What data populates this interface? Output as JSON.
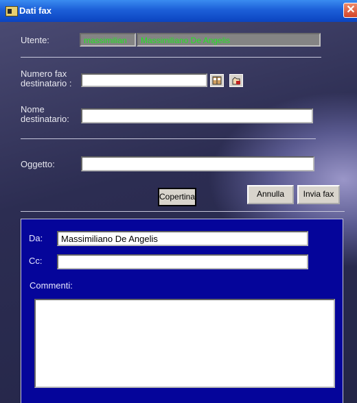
{
  "window": {
    "title": "Dati fax"
  },
  "utente": {
    "label": "Utente:",
    "username": "massimilian",
    "fullname": "Massimiliano De Angelis"
  },
  "numero_fax": {
    "label_line1": "Numero fax",
    "label_line2": "destinatario :",
    "value": ""
  },
  "nome": {
    "label_line1": "Nome",
    "label_line2": "destinatario:",
    "value": ""
  },
  "oggetto": {
    "label": "Oggetto:",
    "value": ""
  },
  "buttons": {
    "copertina": "Copertina",
    "annulla": "Annulla",
    "invia": "Invia fax"
  },
  "cover": {
    "da_label": "Da:",
    "da_value": "Massimiliano De Angelis",
    "cc_label": "Cc:",
    "cc_value": "",
    "commenti_label": "Commenti:",
    "commenti_value": ""
  },
  "icons": {
    "address_book": "address-book-icon",
    "hand": "hand-pick-icon",
    "close": "close-icon"
  },
  "colors": {
    "titlebar": "#1c5fd8",
    "client_bg": "#2c2d52",
    "cover_panel": "#05059a",
    "green_text": "#22e622"
  }
}
